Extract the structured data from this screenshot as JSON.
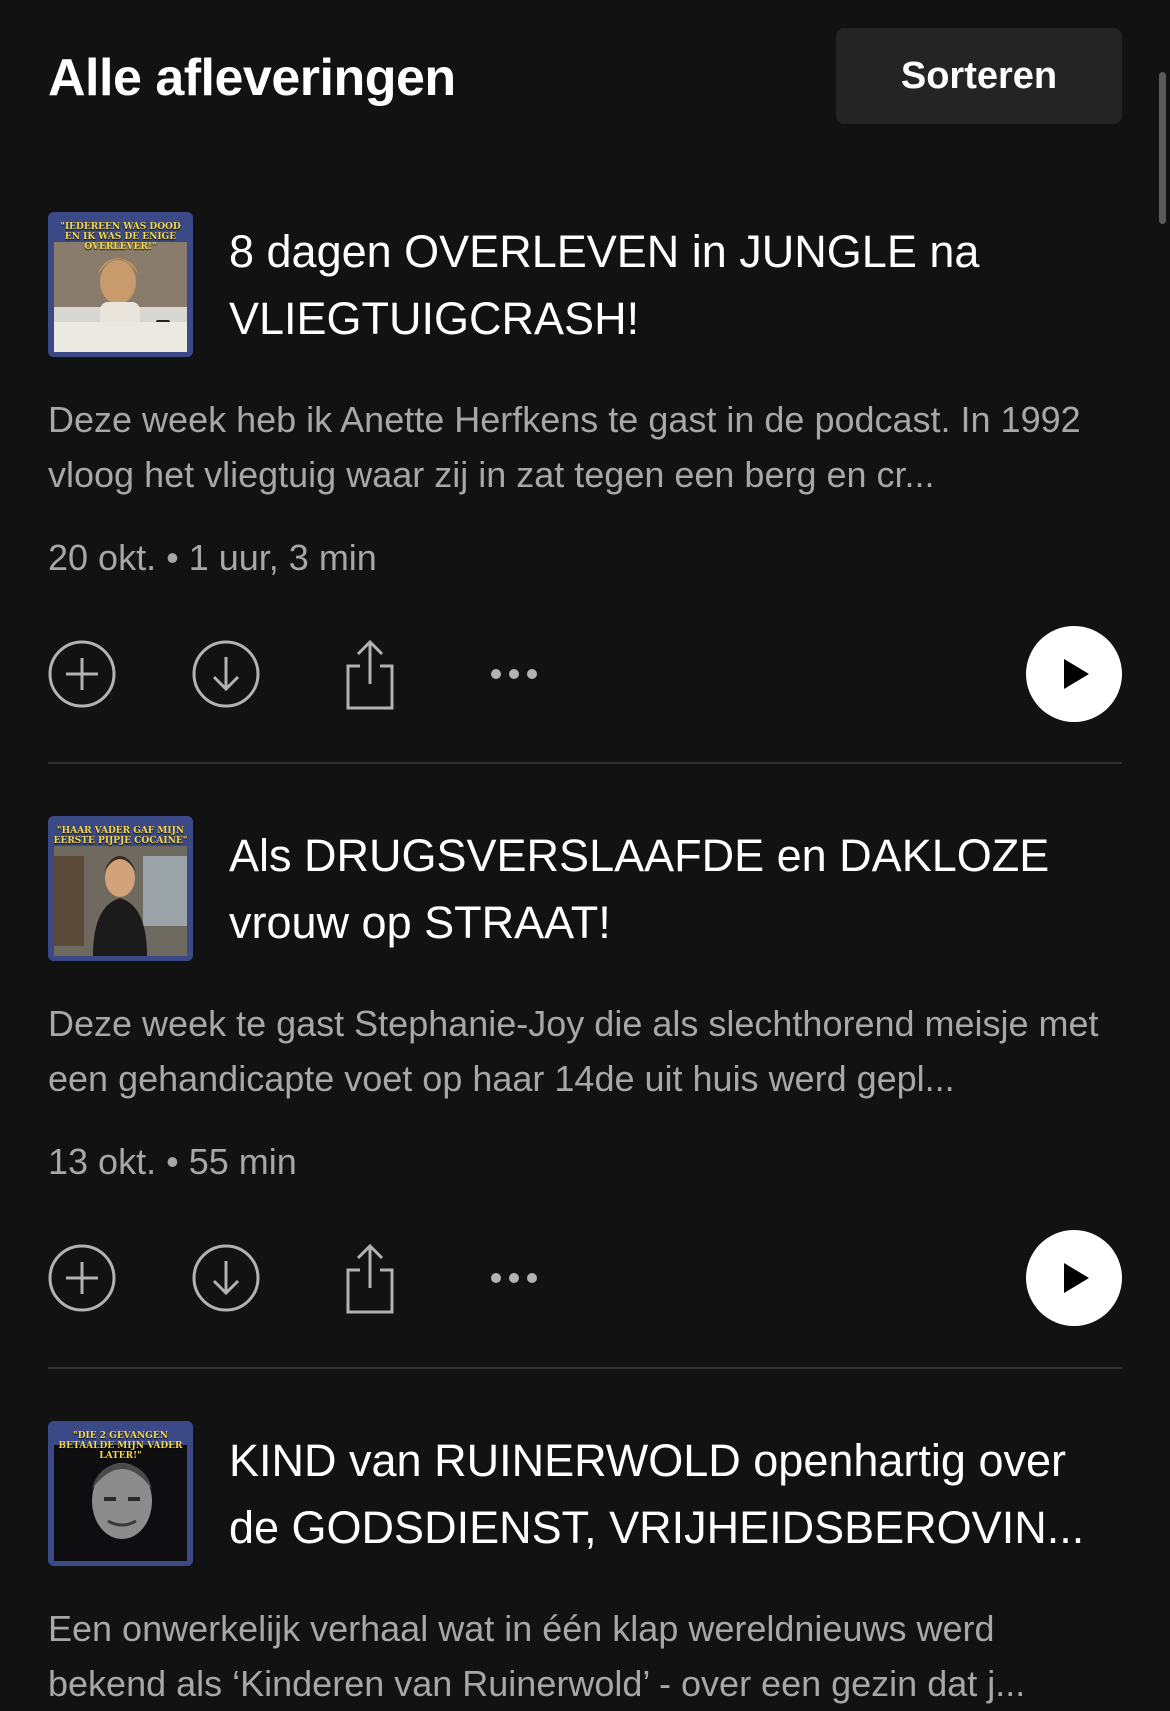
{
  "header": {
    "title": "Alle afleveringen",
    "sort_label": "Sorteren"
  },
  "episodes": [
    {
      "cover_caption": "\"IEDEREEN WAS DOOD EN IK WAS DE ENIGE OVERLEVER!\"",
      "title": "8 dagen OVERLEVEN in JUNGLE na VLIEGTUIGCRASH!",
      "description": "Deze week heb ik Anette Herfkens te gast in de podcast. In 1992 vloog het vliegtuig waar zij in zat tegen een berg en cr...",
      "date": "20 okt.",
      "duration": "1 uur, 3 min"
    },
    {
      "cover_caption": "\"HAAR VADER GAF MIJN EERSTE PIJPJE COCAINE\"",
      "title": "Als DRUGSVERSLAAFDE en DAKLOZE vrouw op STRAAT!",
      "description": "Deze week te gast Stephanie-Joy die als slechthorend meisje met een gehandicapte voet op haar 14de uit huis werd gepl...",
      "date": "13 okt.",
      "duration": "55 min"
    },
    {
      "cover_caption": "\"DIE 2 GEVANGEN BETAALDE MIJN VADER LATER!\"",
      "title": "KIND van RUINERWOLD openhartig over de GODSDIENST, VRIJHEIDSBEROVIN...",
      "description": "Een onwerkelijk verhaal wat in één klap wereldnieuws werd bekend als ‘Kinderen van Ruinerwold’ - over een gezin dat j...",
      "date": "",
      "duration": ""
    }
  ],
  "meta_separator": "•",
  "icons": {
    "add": "plus-circle-icon",
    "download": "download-icon",
    "share": "share-icon",
    "more": "more-options-icon",
    "play": "play-icon"
  }
}
